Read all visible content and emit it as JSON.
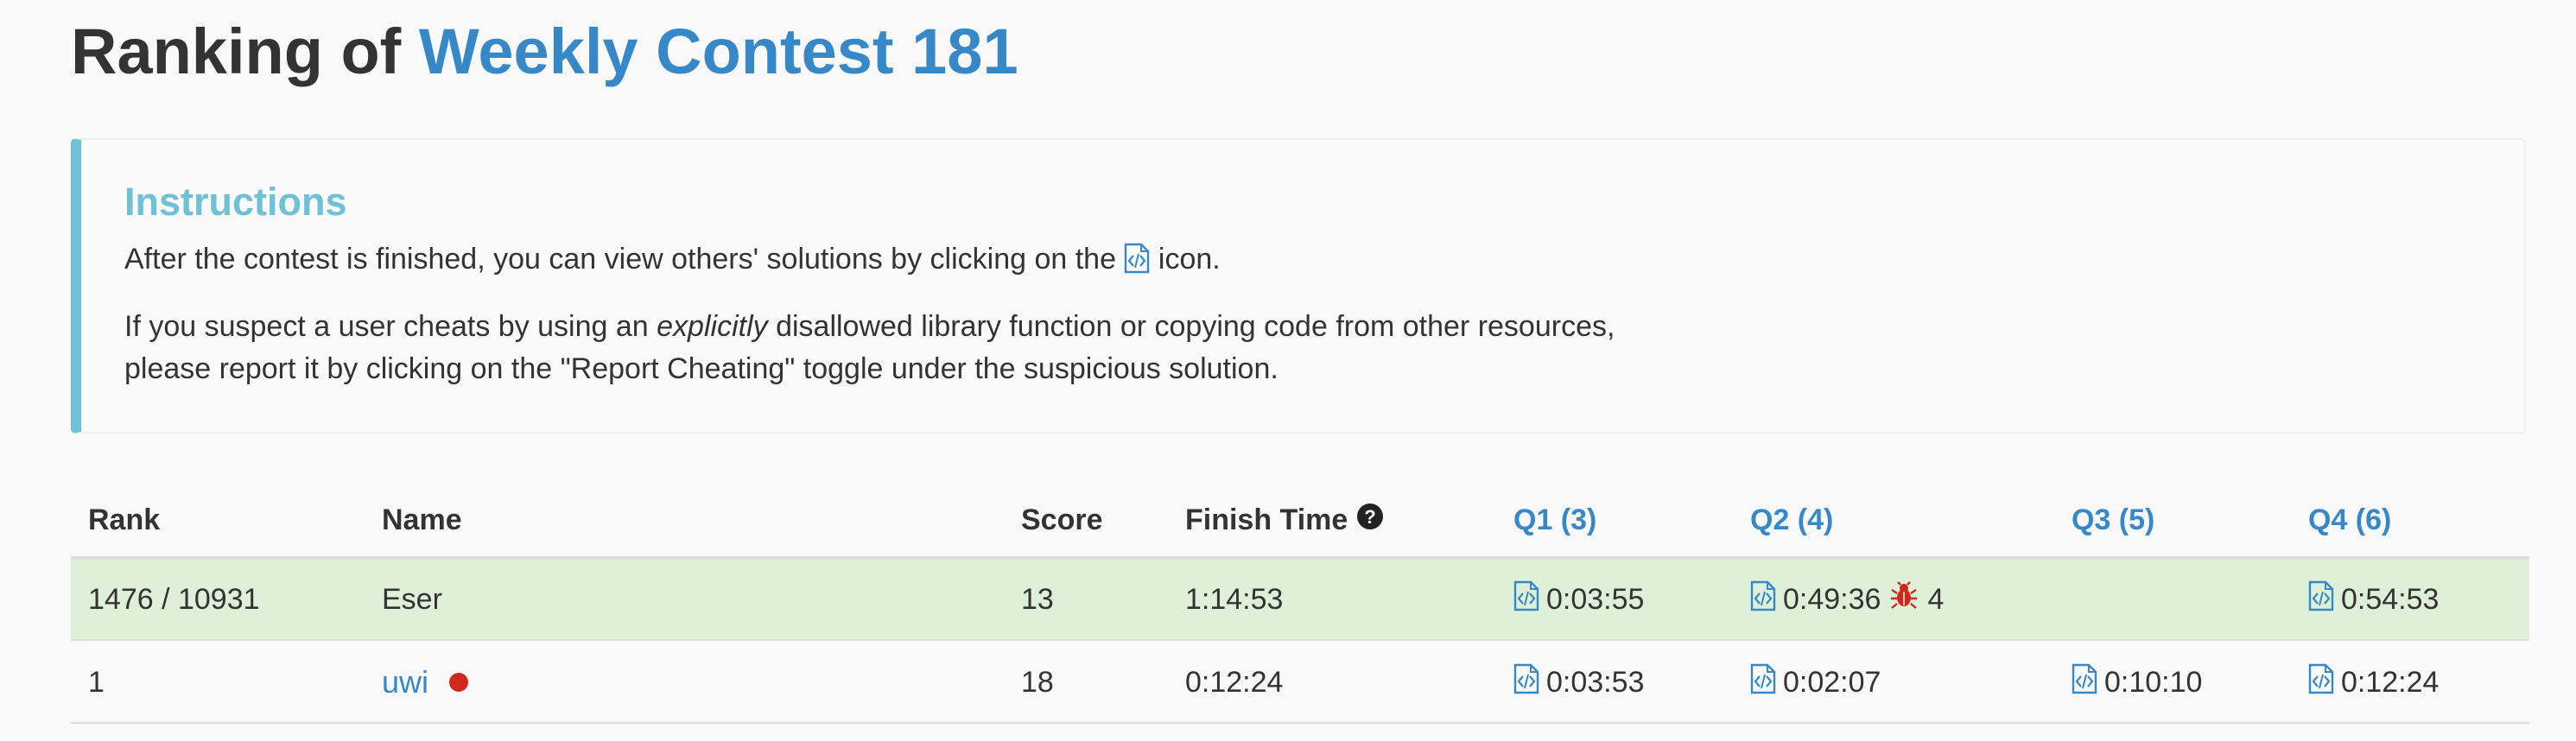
{
  "page": {
    "title_prefix": "Ranking of ",
    "contest_name": "Weekly Contest 181"
  },
  "instructions": {
    "title": "Instructions",
    "line1_before": "After the contest is finished, you can view others' solutions by clicking on the ",
    "line1_after": " icon.",
    "line2_before": "If you suspect a user cheats by using an ",
    "line2_emphasis": "explicitly",
    "line2_after": " disallowed library function or copying code from other resources,",
    "line3": "please report it by clicking on the \"Report Cheating\" toggle under the suspicious solution."
  },
  "table": {
    "headers": {
      "rank": "Rank",
      "name": "Name",
      "score": "Score",
      "finish_time": "Finish Time",
      "q1": "Q1 (3)",
      "q2": "Q2 (4)",
      "q3": "Q3 (5)",
      "q4": "Q4 (6)"
    },
    "rows": [
      {
        "rank": "1476 / 10931",
        "name": "Eser",
        "score": "13",
        "finish_time": "1:14:53",
        "q1": "0:03:55",
        "q2": "0:49:36",
        "q2_wrong": "4",
        "q3": "",
        "q4": "0:54:53",
        "highlighted": true
      },
      {
        "rank": "1",
        "name": "uwi",
        "score": "18",
        "finish_time": "0:12:24",
        "q1": "0:03:53",
        "q2": "0:02:07",
        "q3": "0:10:10",
        "q4": "0:12:24",
        "highlighted": false
      }
    ]
  },
  "icons": {
    "code": "code-file-icon",
    "help": "question-circle-icon",
    "bug": "bug-icon",
    "status": "status-dot"
  },
  "colors": {
    "accent": "#3688c8",
    "info": "#6ec1d6",
    "highlight_row": "#dff0d8",
    "bug": "#d0281d"
  }
}
